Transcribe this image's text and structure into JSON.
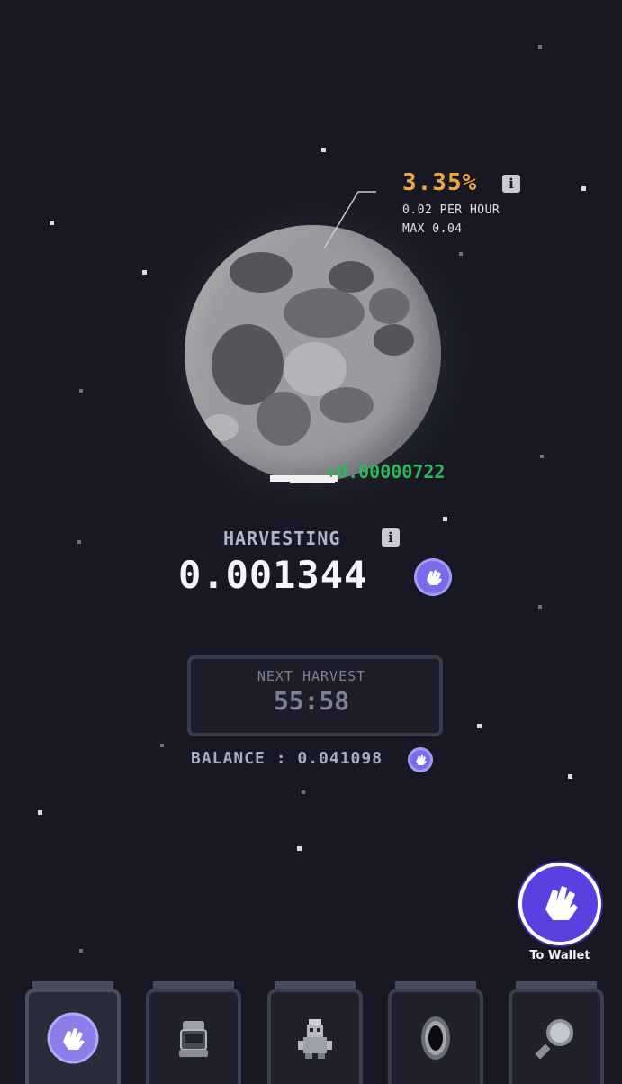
{
  "rate": {
    "percent": "3.35%",
    "per_hour": "0.02 PER HOUR",
    "max": "MAX 0.04",
    "info_icon": "info-icon"
  },
  "gain": "+0.00000722",
  "harvesting": {
    "label": "HARVESTING",
    "value": "0.001344",
    "info_icon": "info-icon",
    "coin_icon": "coin-icon"
  },
  "next_harvest": {
    "label": "NEXT HARVEST",
    "time": "55:58"
  },
  "balance": {
    "label": "BALANCE : 0.041098",
    "coin_icon": "coin-icon"
  },
  "wallet": {
    "label": "To Wallet",
    "icon": "hand-icon"
  },
  "nav": [
    {
      "icon": "moon-coin-icon",
      "active": true
    },
    {
      "icon": "capsule-icon",
      "active": false
    },
    {
      "icon": "robot-icon",
      "active": false
    },
    {
      "icon": "black-hole-icon",
      "active": false
    },
    {
      "icon": "magnifier-icon",
      "active": false
    }
  ],
  "colors": {
    "background": "#171823",
    "rate_percent": "#f0a63a",
    "gain": "#2fb55a",
    "coin": "#7a6be8",
    "wallet_button": "#5b3fe0"
  }
}
